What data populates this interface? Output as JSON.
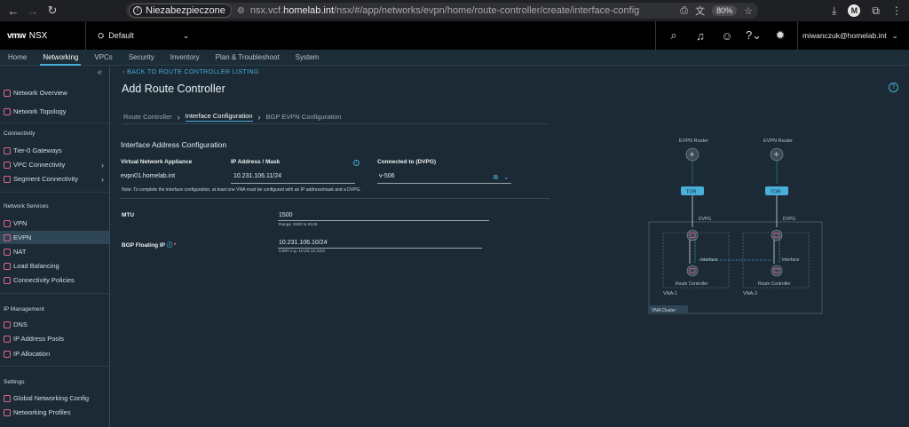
{
  "browser": {
    "security_label": "Niezabezpieczone",
    "url_prefix": "nsx.vcf.",
    "url_domain": "homelab.int",
    "url_path": "/nsx/#/app/networks/evpn/home/route-controller/create/interface-config",
    "zoom": "80%",
    "profile_initial": "M"
  },
  "header": {
    "logo": "vmw",
    "app_name": "NSX",
    "project": "Default",
    "user": "miwanczuk@homelab.int"
  },
  "topnav": [
    "Home",
    "Networking",
    "VPCs",
    "Security",
    "Inventory",
    "Plan & Troubleshoot",
    "System"
  ],
  "topnav_active": "Networking",
  "sidebar": {
    "items": [
      {
        "label": "Network Overview"
      },
      {
        "label": "Network Topology"
      },
      {
        "label": "Tier-0 Gateways"
      },
      {
        "label": "VPC Connectivity"
      },
      {
        "label": "Segment Connectivity"
      },
      {
        "label": "VPN"
      },
      {
        "label": "EVPN"
      },
      {
        "label": "NAT"
      },
      {
        "label": "Load Balancing"
      },
      {
        "label": "Connectivity Policies"
      },
      {
        "label": "DNS"
      },
      {
        "label": "IP Address Pools"
      },
      {
        "label": "IP Allocation"
      },
      {
        "label": "Global Networking Config"
      },
      {
        "label": "Networking Profiles"
      }
    ],
    "sections": [
      "Connectivity",
      "Network Services",
      "IP Management",
      "Settings"
    ]
  },
  "page": {
    "back_link": "BACK TO ROUTE CONTROLLER LISTING",
    "title": "Add Route Controller",
    "steps": [
      "Route Controller",
      "Interface Configuration",
      "BGP EVPN Configuration"
    ],
    "active_step": "Interface Configuration",
    "section_title": "Interface Address Configuration",
    "columns": [
      "Virtual Network Appliance",
      "IP Address / Mask",
      "Connected to (DVPG)"
    ],
    "row": {
      "appliance": "evpn01.homelab.int",
      "ip": "10.231.106.11/24",
      "dvpg": "v-506"
    },
    "note": "Note: To complete the interface configuration, at least one VNA must be configured with an IP address/mask and a DVPG.",
    "mtu": {
      "label": "MTU",
      "value": "1500",
      "hint": "Range 1500 to 9126"
    },
    "bgp": {
      "label": "BGP Floating IP",
      "value": "10.231.106.10/24",
      "hint": "CIDR e.g. 10.22.12.2/23"
    }
  },
  "diagram": {
    "router_left": "EVPN Router",
    "router_right": "EVPN Router",
    "tor": "TOR",
    "dvpg": "DVPG",
    "interface": "Interface",
    "rc": "Route Controller",
    "vna1": "VNA-1",
    "vna2": "VNA-2",
    "cluster": "VNA Cluster"
  },
  "colors": {
    "accent": "#49afd9",
    "icon_pink": "#e0678a",
    "bg": "#1b2a35"
  }
}
